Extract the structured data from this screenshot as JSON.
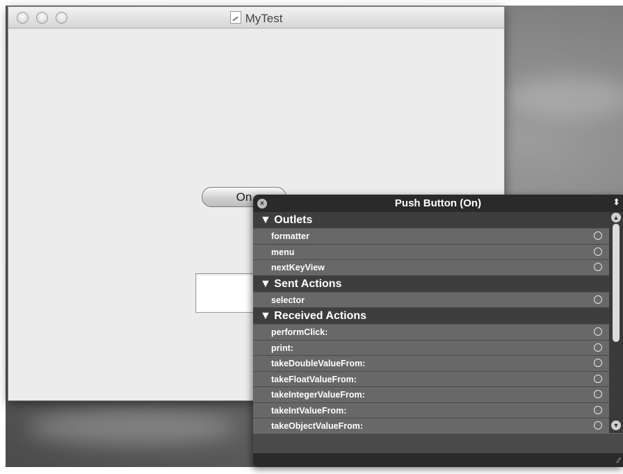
{
  "window": {
    "title": "MyTest",
    "on_button_label": "On"
  },
  "panel": {
    "title": "Push Button (On)",
    "sections": [
      {
        "label": "Outlets",
        "items": [
          "formatter",
          "menu",
          "nextKeyView"
        ]
      },
      {
        "label": "Sent Actions",
        "items": [
          "selector"
        ]
      },
      {
        "label": "Received Actions",
        "items": [
          "performClick:",
          "print:",
          "takeDoubleValueFrom:",
          "takeFloatValueFrom:",
          "takeIntegerValueFrom:",
          "takeIntValueFrom:",
          "takeObjectValueFrom:"
        ]
      }
    ]
  },
  "icons": {
    "close": "close-icon",
    "document": "document-icon",
    "connection": "connection-circle-icon"
  }
}
